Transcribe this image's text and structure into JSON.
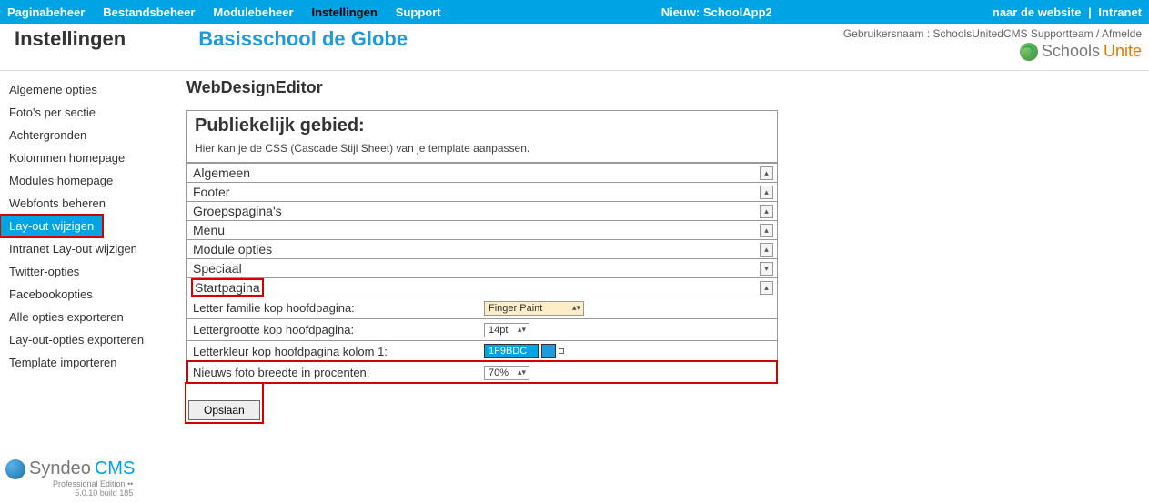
{
  "top_nav": {
    "items": [
      "Paginabeheer",
      "Bestandsbeheer",
      "Modulebeheer",
      "Instellingen",
      "Support"
    ],
    "active_index": 3
  },
  "top_center": "Nieuw: SchoolApp2",
  "top_right": {
    "website": "naar de website",
    "intranet": "Intranet",
    "sep": "|"
  },
  "header": {
    "page_title": "Instellingen",
    "school": "Basisschool de Globe",
    "user_label": "Gebruikersnaam : ",
    "user": "SchoolsUnitedCMS Supportteam",
    "logout": "Afmelde",
    "brand_a": "Schools",
    "brand_b": "Unite"
  },
  "sidebar": {
    "items": [
      "Algemene opties",
      "Foto's per sectie",
      "Achtergronden",
      "Kolommen homepage",
      "Modules homepage",
      "Webfonts beheren",
      "Lay-out wijzigen",
      "Intranet Lay-out wijzigen",
      "Twitter-opties",
      "Facebookopties",
      "Alle opties exporteren",
      "Lay-out-opties exporteren",
      "Template importeren"
    ],
    "active_index": 6
  },
  "content": {
    "title": "WebDesignEditor",
    "panel_title": "Publiekelijk gebied:",
    "panel_help": "Hier kan je de CSS (Cascade Stijl Sheet) van je template aanpassen.",
    "sections": [
      "Algemeen",
      "Footer",
      "Groepspagina's",
      "Menu",
      "Module opties",
      "Speciaal",
      "Startpagina"
    ],
    "expanded_index": 6,
    "options": {
      "font_family_label": "Letter familie kop hoofdpagina:",
      "font_family_value": "Finger Paint",
      "font_size_label": "Lettergrootte kop hoofdpagina:",
      "font_size_value": "14pt",
      "font_color_label": "Letterkleur kop hoofdpagina kolom 1:",
      "font_color_value": "1F9BDC",
      "news_width_label": "Nieuws foto breedte in procenten:",
      "news_width_value": "70%"
    },
    "save": "Opslaan"
  },
  "footer_brand": {
    "a": "Syndeo",
    "b": "CMS",
    "sub1": "Professional Edition ••",
    "sub2": "5.0.10 build 185"
  }
}
